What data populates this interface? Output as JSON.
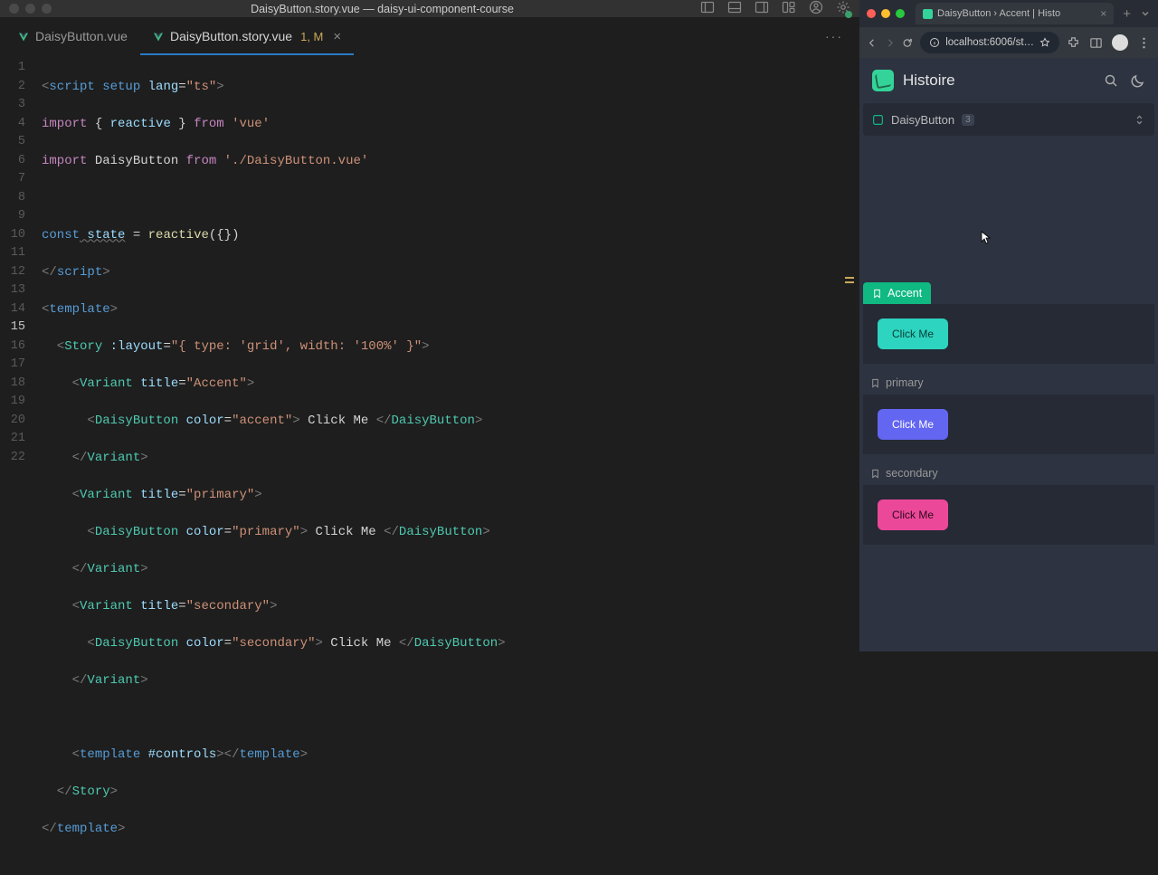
{
  "vscode": {
    "title": "DaisyButton.story.vue — daisy-ui-component-course",
    "tabs": [
      {
        "label": "DaisyButton.vue",
        "active": false,
        "status": ""
      },
      {
        "label": "DaisyButton.story.vue",
        "active": true,
        "status": "1, M"
      }
    ],
    "lines": [
      "1",
      "2",
      "3",
      "4",
      "5",
      "6",
      "7",
      "8",
      "9",
      "10",
      "11",
      "12",
      "13",
      "14",
      "15",
      "16",
      "17",
      "18",
      "19",
      "20",
      "21",
      "22"
    ],
    "currentLine": "15",
    "code": {
      "l1": {
        "a": "<",
        "b": "script setup",
        "c": " lang",
        "d": "=",
        "e": "\"ts\"",
        "f": ">"
      },
      "l2": {
        "a": "import",
        "b": " { ",
        "c": "reactive",
        "d": " } ",
        "e": "from",
        "f": " 'vue'"
      },
      "l3": {
        "a": "import",
        "b": " DaisyButton ",
        "c": "from",
        "d": " './DaisyButton.vue'"
      },
      "l5": {
        "a": "const",
        "b": " state",
        "c": " = ",
        "d": "reactive",
        "e": "({})"
      },
      "l6": {
        "a": "</",
        "b": "script",
        "c": ">"
      },
      "l7": {
        "a": "<",
        "b": "template",
        "c": ">"
      },
      "l8": {
        "a": "  <",
        "b": "Story",
        "c": " :layout",
        "d": "=",
        "e": "\"{ type: 'grid', width: '100%' }\"",
        "f": ">"
      },
      "l9": {
        "a": "    <",
        "b": "Variant",
        "c": " title",
        "d": "=",
        "e": "\"Accent\"",
        "f": ">"
      },
      "l10": {
        "a": "      <",
        "b": "DaisyButton",
        "c": " color",
        "d": "=",
        "e": "\"accent\"",
        "f": ">",
        "g": " Click Me ",
        "h": "</",
        "i": "DaisyButton",
        "j": ">"
      },
      "l11": {
        "a": "    </",
        "b": "Variant",
        "c": ">"
      },
      "l12": {
        "a": "    <",
        "b": "Variant",
        "c": " title",
        "d": "=",
        "e": "\"primary\"",
        "f": ">"
      },
      "l13": {
        "a": "      <",
        "b": "DaisyButton",
        "c": " color",
        "d": "=",
        "e": "\"primary\"",
        "f": ">",
        "g": " Click Me ",
        "h": "</",
        "i": "DaisyButton",
        "j": ">"
      },
      "l14": {
        "a": "    </",
        "b": "Variant",
        "c": ">"
      },
      "l15": {
        "a": "    <",
        "b": "Variant",
        "c": " title",
        "d": "=",
        "e": "\"secondary\"",
        "f": ">"
      },
      "l16": {
        "a": "      <",
        "b": "DaisyButton",
        "c": " color",
        "d": "=",
        "e": "\"secondary\"",
        "f": ">",
        "g": " Click Me ",
        "h": "</",
        "i": "DaisyButton",
        "j": ">"
      },
      "l17": {
        "a": "    </",
        "b": "Variant",
        "c": ">"
      },
      "l19": {
        "a": "    <",
        "b": "template",
        "c": " #controls",
        "d": "></",
        "e": "template",
        "f": ">"
      },
      "l20": {
        "a": "  </",
        "b": "Story",
        "c": ">"
      },
      "l21": {
        "a": "</",
        "b": "template",
        "c": ">"
      }
    }
  },
  "browser": {
    "tabTitle": "DaisyButton › Accent | Histo",
    "url": "localhost:6006/st…"
  },
  "histoire": {
    "title": "Histoire",
    "storyName": "DaisyButton",
    "storyCount": "3",
    "variants": [
      {
        "name": "Accent",
        "btnLabel": "Click Me",
        "selected": true,
        "btnClass": "btn-accent"
      },
      {
        "name": "primary",
        "btnLabel": "Click Me",
        "selected": false,
        "btnClass": "btn-primary"
      },
      {
        "name": "secondary",
        "btnLabel": "Click Me",
        "selected": false,
        "btnClass": "btn-secondary"
      }
    ]
  }
}
